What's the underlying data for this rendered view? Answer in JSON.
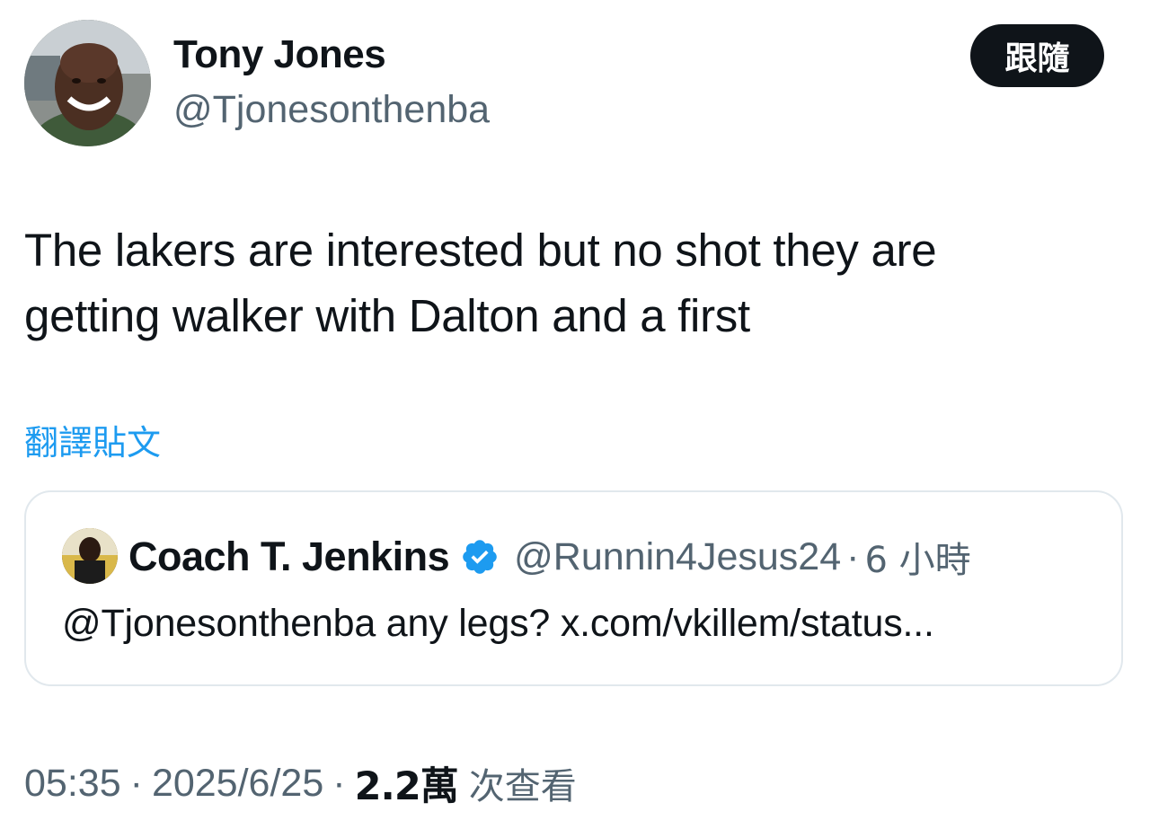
{
  "author": {
    "name": "Tony Jones",
    "handle": "@Tjonesonthenba"
  },
  "follow_label": "跟隨",
  "tweet": {
    "text_lines": [
      "The lakers are interested but no shot they are",
      "getting walker with Dalton and a first"
    ],
    "translate_label": "翻譯貼文"
  },
  "quote": {
    "name": "Coach T. Jenkins",
    "verified": true,
    "handle": "@Runnin4Jesus24",
    "separator": "·",
    "time": "6 小時",
    "text": "@Tjonesonthenba any legs? x.com/vkillem/status..."
  },
  "meta": {
    "time": "05:35",
    "separator": "·",
    "date": "2025/6/25",
    "views_count": "2.2萬",
    "views_label": "次查看"
  },
  "colors": {
    "accent": "#1d9bf0",
    "text_primary": "#0f1419",
    "text_secondary": "#536471",
    "border": "#e1e8ed"
  },
  "icons": {
    "verified": "verified-badge-icon"
  }
}
